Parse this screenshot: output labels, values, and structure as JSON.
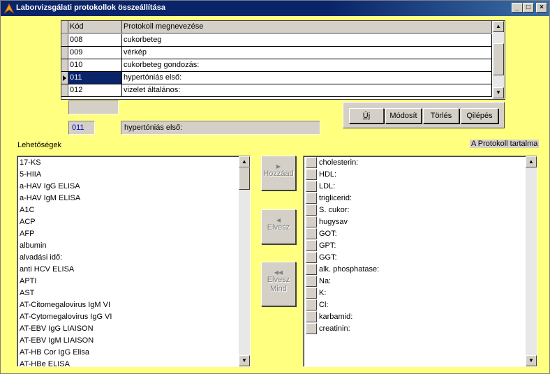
{
  "window": {
    "title": "Laborvizsgálati protokollok összeállítása",
    "min_glyph": "_",
    "max_glyph": "□",
    "close_glyph": "×"
  },
  "grid": {
    "columns": [
      "Kód",
      "Protokoll megnevezése"
    ],
    "rows": [
      {
        "code": "008",
        "name": "cukorbeteg"
      },
      {
        "code": "009",
        "name": "vérkép"
      },
      {
        "code": "010",
        "name": "cukorbeteg gondozás:"
      },
      {
        "code": "011",
        "name": "hypertóniás első:"
      },
      {
        "code": "012",
        "name": "vizelet általános:"
      }
    ],
    "selected_index": 3
  },
  "fields": {
    "search": "",
    "code": "011",
    "name": "hypertóniás első:"
  },
  "buttons": {
    "new": "Új",
    "edit": "Módosít",
    "delete": "Törlés",
    "exit": "Qilépés",
    "add": "Hozzáad",
    "remove": "Elvesz",
    "remove_all_1": "Elvesz",
    "remove_all_2": "Mind"
  },
  "labels": {
    "options": "Lehetőségek",
    "protocol_content": "A Protokoll tartalma"
  },
  "options_list": [
    "17-KS",
    "5-HIIA",
    "a-HAV IgG ELISA",
    "a-HAV IgM ELISA",
    "A1C",
    "ACP",
    "AFP",
    "albumin",
    "alvadási idő:",
    "anti HCV ELISA",
    "APTI",
    "AST",
    "AT-Citomegalovirus IgM VI",
    "AT-Cytomegalovirus IgG VI",
    "AT-EBV IgG LIAISON",
    "AT-EBV IgM LIAISON",
    "AT-HB Cor IgG Elisa",
    "AT-HBe ELISA"
  ],
  "protocol_list": [
    "cholesterin:",
    "HDL:",
    "LDL:",
    "triglicerid:",
    "S. cukor:",
    "hugysav",
    "GOT:",
    "GPT:",
    "GGT:",
    "alk. phosphatase:",
    "Na:",
    "K:",
    "Cl:",
    "karbamid:",
    "creatinin:"
  ],
  "colors": {
    "background": "#ffff80",
    "selection": "#0a246a",
    "code_text": "#0000cc"
  }
}
